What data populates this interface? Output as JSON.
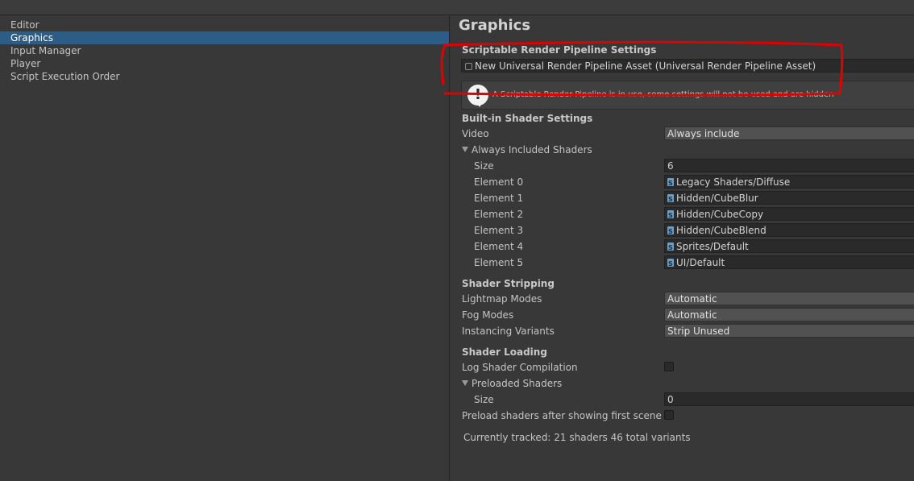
{
  "sidebar": {
    "items": [
      {
        "label": "Editor",
        "selected": false
      },
      {
        "label": "Graphics",
        "selected": true
      },
      {
        "label": "Input Manager",
        "selected": false
      },
      {
        "label": "Player",
        "selected": false
      },
      {
        "label": "Script Execution Order",
        "selected": false
      }
    ]
  },
  "main": {
    "title": "Graphics",
    "srp": {
      "header": "Scriptable Render Pipeline Settings",
      "asset_value": "New Universal Render Pipeline Asset (Universal Render Pipeline Asset)",
      "asset_icon": "render-pipeline-asset-icon",
      "help_text": "A Scriptable Render Pipeline is in use, some settings will not be used and are hidden",
      "help_icon": "warning-icon"
    },
    "builtin": {
      "header": "Built-in Shader Settings",
      "video_label": "Video",
      "video_value": "Always include",
      "always_included_label": "Always Included Shaders",
      "size_label": "Size",
      "size_value": "6",
      "elements": [
        {
          "label": "Element 0",
          "value": "Legacy Shaders/Diffuse"
        },
        {
          "label": "Element 1",
          "value": "Hidden/CubeBlur"
        },
        {
          "label": "Element 2",
          "value": "Hidden/CubeCopy"
        },
        {
          "label": "Element 3",
          "value": "Hidden/CubeBlend"
        },
        {
          "label": "Element 4",
          "value": "Sprites/Default"
        },
        {
          "label": "Element 5",
          "value": "UI/Default"
        }
      ]
    },
    "stripping": {
      "header": "Shader Stripping",
      "lightmap_label": "Lightmap Modes",
      "lightmap_value": "Automatic",
      "fog_label": "Fog Modes",
      "fog_value": "Automatic",
      "instancing_label": "Instancing Variants",
      "instancing_value": "Strip Unused"
    },
    "loading": {
      "header": "Shader Loading",
      "log_label": "Log Shader Compilation",
      "log_checked": false,
      "preloaded_label": "Preloaded Shaders",
      "size_label": "Size",
      "size_value": "0",
      "preload_after_label": "Preload shaders after showing first scene",
      "preload_after_checked": false
    },
    "tracked_text": "Currently tracked: 21 shaders 46 total variants"
  },
  "colors": {
    "selection": "#2c5d87",
    "annotation": "#e00000",
    "background": "#383838"
  }
}
